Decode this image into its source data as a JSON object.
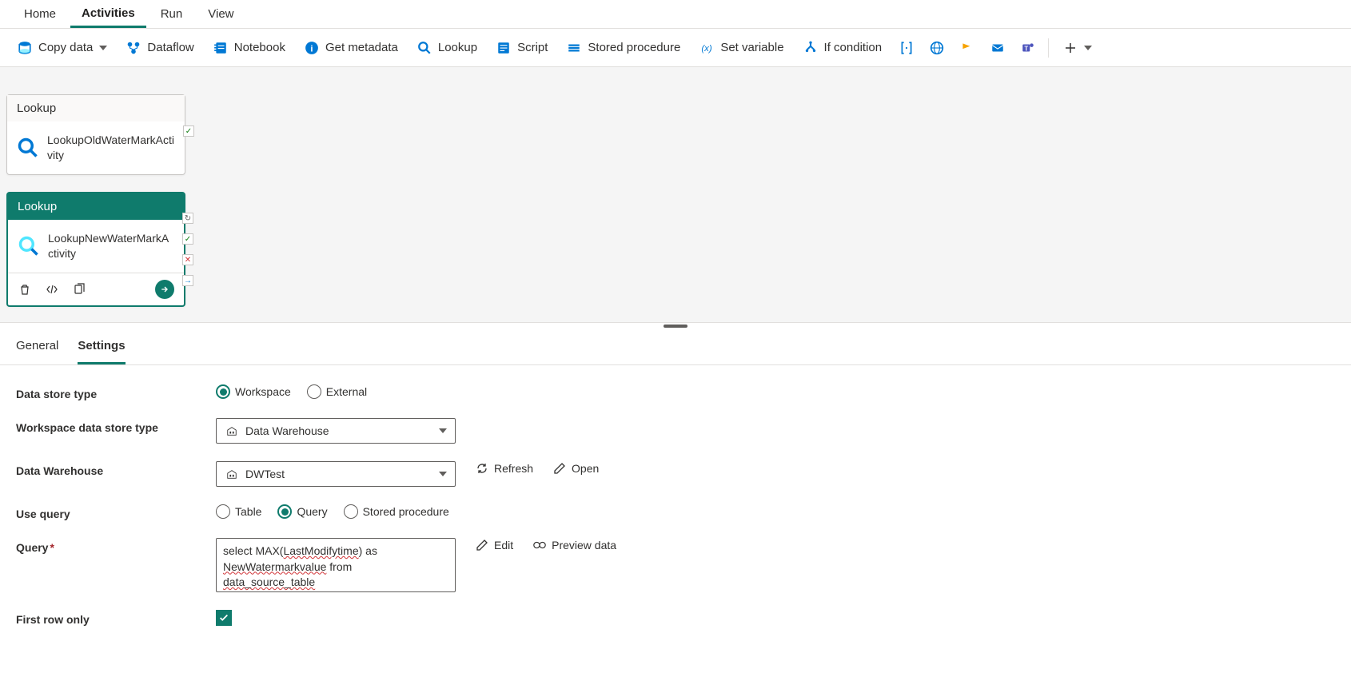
{
  "menu": {
    "home": "Home",
    "activities": "Activities",
    "run": "Run",
    "view": "View"
  },
  "toolbar": {
    "copy_data": "Copy data",
    "dataflow": "Dataflow",
    "notebook": "Notebook",
    "get_metadata": "Get metadata",
    "lookup": "Lookup",
    "script": "Script",
    "stored_procedure": "Stored procedure",
    "set_variable": "Set variable",
    "if_condition": "If condition"
  },
  "activities": {
    "node1": {
      "type": "Lookup",
      "name": "LookupOldWaterMarkActivity"
    },
    "node2": {
      "type": "Lookup",
      "name": "LookupNewWaterMarkActivity"
    }
  },
  "tabs": {
    "general": "General",
    "settings": "Settings"
  },
  "settings": {
    "labels": {
      "data_store_type": "Data store type",
      "workspace_ds_type": "Workspace data store type",
      "data_warehouse": "Data Warehouse",
      "use_query": "Use query",
      "query": "Query",
      "first_row_only": "First row only"
    },
    "data_store_type": {
      "workspace": "Workspace",
      "external": "External"
    },
    "workspace_ds_type_value": "Data Warehouse",
    "data_warehouse_value": "DWTest",
    "actions": {
      "refresh": "Refresh",
      "open": "Open",
      "edit": "Edit",
      "preview_data": "Preview data"
    },
    "use_query": {
      "table": "Table",
      "query": "Query",
      "stored_procedure": "Stored procedure"
    },
    "query_value_line1": "select MAX(LastModifytime) as",
    "query_value_line2": "NewWatermarkvalue from",
    "query_value_line3": "data_source_table"
  }
}
